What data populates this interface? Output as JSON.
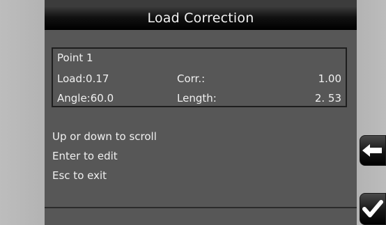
{
  "window": {
    "title": "Load Correction"
  },
  "point": {
    "name": "Point 1",
    "load_label": "Load:",
    "load_value": "0.17",
    "corr_label": "Corr.:",
    "corr_value": "1.00",
    "angle_label": "Angle:",
    "angle_value": "60.0",
    "length_label": "Length:",
    "length_value": "2. 53"
  },
  "instructions": [
    "Up or down to scroll",
    "Enter to edit",
    "Esc to exit"
  ],
  "buttons": {
    "back_icon": "arrow-left-icon",
    "ok_icon": "checkmark-icon"
  },
  "colors": {
    "panel_bg": "#575757",
    "titlebar_bg": "#000000",
    "text": "#f0f0f0",
    "bezel": "#b9b9b9"
  }
}
